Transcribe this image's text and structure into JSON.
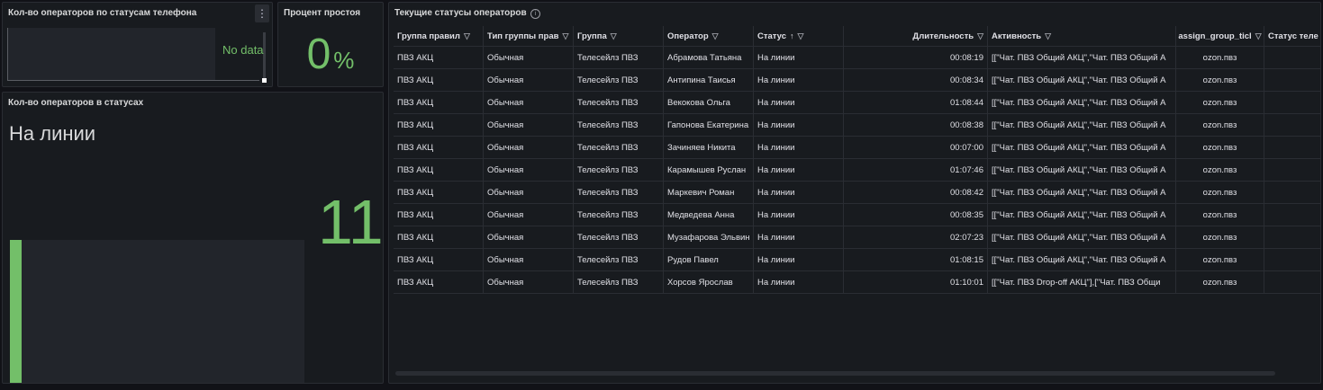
{
  "phone_status_panel": {
    "title": "Кол-во операторов по статусам телефона",
    "no_data": "No data",
    "menu_icon": "⋮"
  },
  "idle_panel": {
    "title": "Процент простоя",
    "value": "0",
    "unit": "%"
  },
  "status_count_panel": {
    "title": "Кол-во операторов в статусах",
    "status_label": "На линии",
    "value": "11",
    "gauge_fill_fraction": 0.04
  },
  "table_panel": {
    "title": "Текущие статусы операторов",
    "info_icon": "i",
    "filter_icon": "▽",
    "sort_icon": "↑",
    "columns": [
      "Группа правил",
      "Тип группы прав",
      "Группа",
      "Оператор",
      "Статус",
      "Длительность",
      "Активность",
      "assign_group_ticl",
      "Статус теле"
    ],
    "rows": [
      [
        "ПВЗ АКЦ",
        "Обычная",
        "Телесейлз ПВЗ",
        "Абрамова Татьяна",
        "На линии",
        "00:08:19",
        "[[\"Чат. ПВЗ Общий АКЦ\",\"Чат. ПВЗ Общий А",
        "ozon.пвз",
        ""
      ],
      [
        "ПВЗ АКЦ",
        "Обычная",
        "Телесейлз ПВЗ",
        "Антипина Таисья",
        "На линии",
        "00:08:34",
        "[[\"Чат. ПВЗ Общий АКЦ\",\"Чат. ПВЗ Общий А",
        "ozon.пвз",
        ""
      ],
      [
        "ПВЗ АКЦ",
        "Обычная",
        "Телесейлз ПВЗ",
        "Векокова Ольга",
        "На линии",
        "01:08:44",
        "[[\"Чат. ПВЗ Общий АКЦ\",\"Чат. ПВЗ Общий А",
        "ozon.пвз",
        ""
      ],
      [
        "ПВЗ АКЦ",
        "Обычная",
        "Телесейлз ПВЗ",
        "Гапонова Екатерина",
        "На линии",
        "00:08:38",
        "[[\"Чат. ПВЗ Общий АКЦ\",\"Чат. ПВЗ Общий А",
        "ozon.пвз",
        ""
      ],
      [
        "ПВЗ АКЦ",
        "Обычная",
        "Телесейлз ПВЗ",
        "Зачиняев Никита",
        "На линии",
        "00:07:00",
        "[[\"Чат. ПВЗ Общий АКЦ\",\"Чат. ПВЗ Общий А",
        "ozon.пвз",
        ""
      ],
      [
        "ПВЗ АКЦ",
        "Обычная",
        "Телесейлз ПВЗ",
        "Карамышев Руслан",
        "На линии",
        "01:07:46",
        "[[\"Чат. ПВЗ Общий АКЦ\",\"Чат. ПВЗ Общий А",
        "ozon.пвз",
        ""
      ],
      [
        "ПВЗ АКЦ",
        "Обычная",
        "Телесейлз ПВЗ",
        "Маркевич Роман",
        "На линии",
        "00:08:42",
        "[[\"Чат. ПВЗ Общий АКЦ\",\"Чат. ПВЗ Общий А",
        "ozon.пвз",
        ""
      ],
      [
        "ПВЗ АКЦ",
        "Обычная",
        "Телесейлз ПВЗ",
        "Медведева Анна",
        "На линии",
        "00:08:35",
        "[[\"Чат. ПВЗ Общий АКЦ\",\"Чат. ПВЗ Общий А",
        "ozon.пвз",
        ""
      ],
      [
        "ПВЗ АКЦ",
        "Обычная",
        "Телесейлз ПВЗ",
        "Музафарова Эльвин",
        "На линии",
        "02:07:23",
        "[[\"Чат. ПВЗ Общий АКЦ\",\"Чат. ПВЗ Общий А",
        "ozon.пвз",
        ""
      ],
      [
        "ПВЗ АКЦ",
        "Обычная",
        "Телесейлз ПВЗ",
        "Рудов Павел",
        "На линии",
        "01:08:15",
        "[[\"Чат. ПВЗ Общий АКЦ\",\"Чат. ПВЗ Общий А",
        "ozon.пвз",
        ""
      ],
      [
        "ПВЗ АКЦ",
        "Обычная",
        "Телесейлз ПВЗ",
        "Хорсов Ярослав",
        "На линии",
        "01:10:01",
        "[[\"Чат. ПВЗ Drop-off АКЦ\"],[\"Чат. ПВЗ Общи",
        "ozon.пвз",
        ""
      ]
    ]
  },
  "colors": {
    "background": "#111217",
    "panel": "#181b1f",
    "accent_green": "#73bf69"
  }
}
